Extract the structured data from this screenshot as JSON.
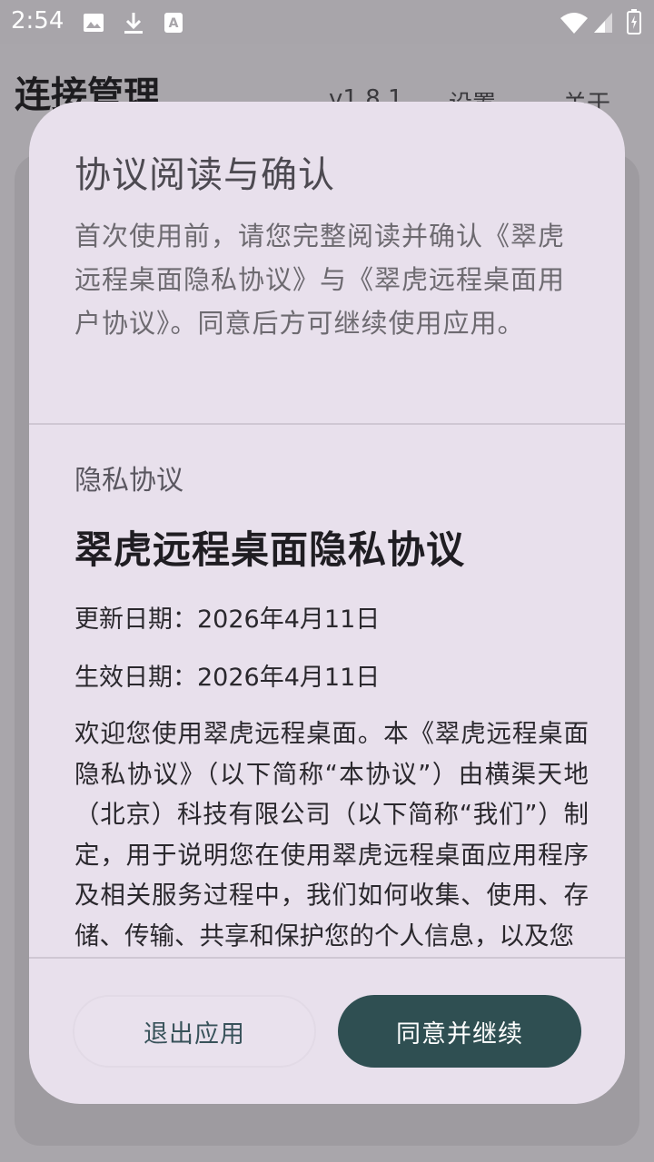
{
  "status_bar": {
    "time": "2:54",
    "icons": [
      "image-icon",
      "download-icon",
      "text-icon",
      "wifi-icon",
      "signal-icon",
      "battery-charging-icon"
    ]
  },
  "app": {
    "title": "连接管理",
    "menu": {
      "version": "v1.8.1",
      "settings": "设置",
      "about": "关于"
    }
  },
  "dialog": {
    "title": "协议阅读与确认",
    "intro": "首次使用前，请您完整阅读并确认《翠虎远程桌面隐私协议》与《翠虎远程桌面用户协议》。同意后方可继续使用应用。",
    "section_label": "隐私协议",
    "document": {
      "title": "翠虎远程桌面隐私协议",
      "updated": "更新日期：2026年4月11日",
      "effective": "生效日期：2026年4月11日",
      "body": "欢迎您使用翠虎远程桌面。本《翠虎远程桌面隐私协议》（以下简称“本协议”）由横渠天地（北京）科技有限公司（以下简称“我们”）制定，用于说明您在使用翠虎远程桌面应用程序及相关服务过程中，我们如何收集、使用、存储、传输、共享和保护您的个人信息，以及您"
    },
    "buttons": {
      "exit": "退出应用",
      "agree": "同意并继续"
    },
    "colors": {
      "dialog_bg": "#e8e0ec",
      "primary": "#2f4f52"
    }
  }
}
